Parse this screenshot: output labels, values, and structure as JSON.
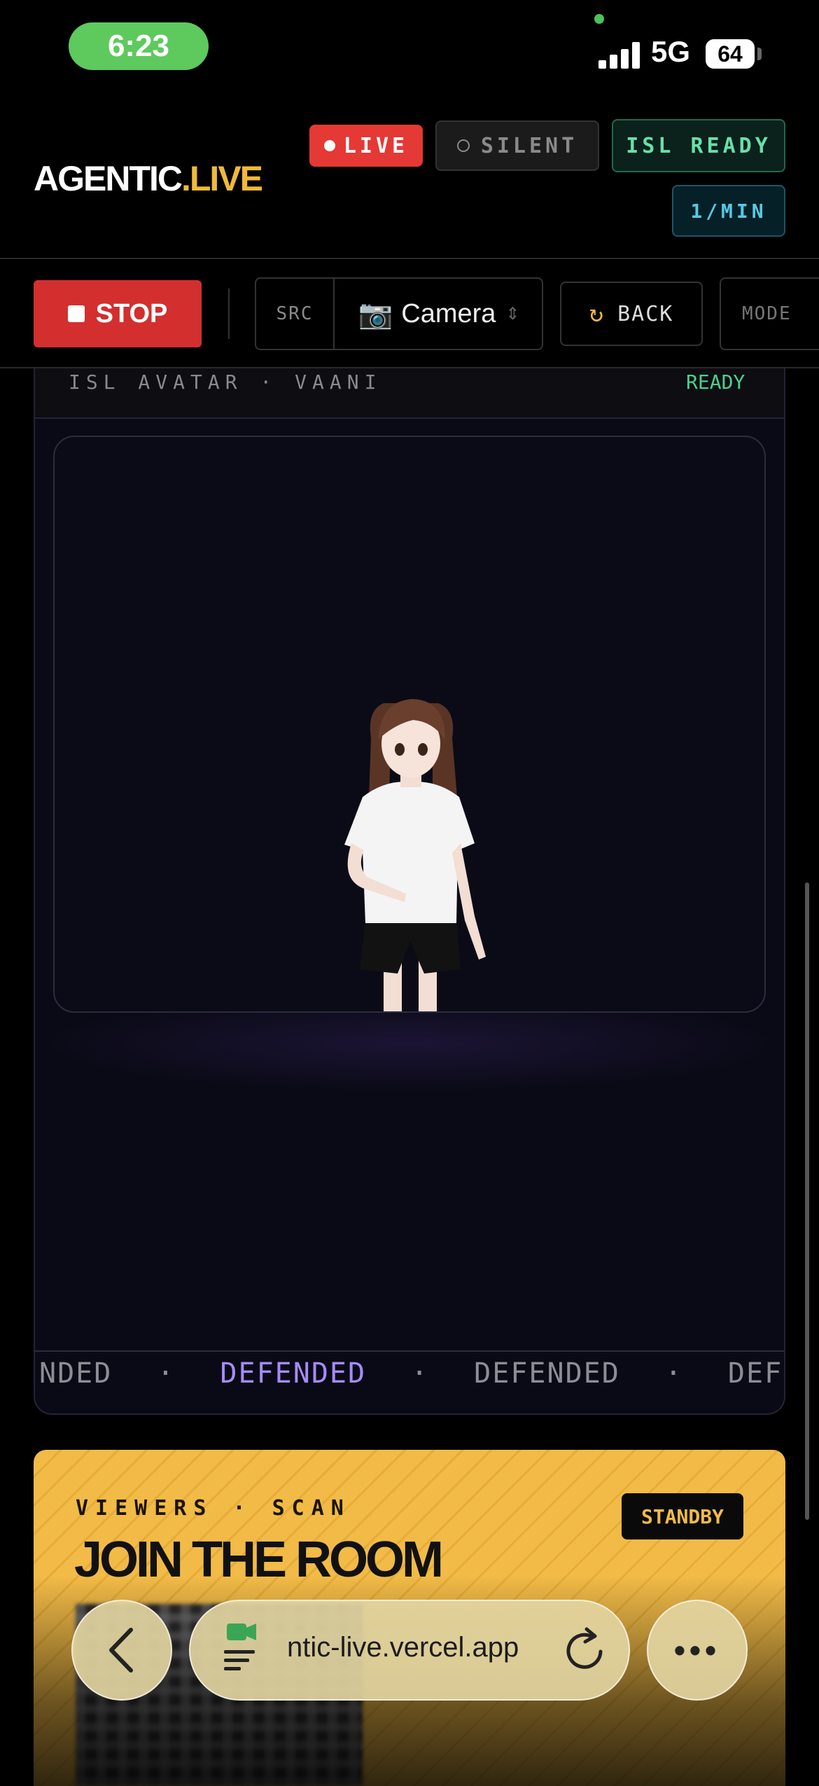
{
  "status_bar": {
    "time": "6:23",
    "network": "5G",
    "battery": "64"
  },
  "header": {
    "logo_main": "AGENTIC",
    "logo_accent": ".LIVE",
    "live_label": "LIVE",
    "silent_label": "SILENT",
    "isl_label": "ISL READY",
    "rate_label": "1/MIN"
  },
  "toolbar": {
    "stop_label": "STOP",
    "src_label": "SRC",
    "source_value": "Camera",
    "back_label": "BACK",
    "mode_label": "MODE"
  },
  "avatar_panel": {
    "title": "ISL AVATAR · VAANI",
    "status": "READY",
    "ticker": [
      "NDED",
      "DEFENDED",
      "DEFENDED",
      "DEFE"
    ],
    "ticker_sep": "·"
  },
  "join_card": {
    "label": "VIEWERS · SCAN",
    "title": "JOIN THE ROOM",
    "badge": "STANDBY"
  },
  "browser": {
    "url": "ntic-live.vercel.app"
  },
  "colors": {
    "live": "#e53935",
    "isl_ready": "#68e0a8",
    "rate": "#57c9e4",
    "accent": "#f0b93a",
    "stop": "#d32f2f",
    "ticker_highlight": "#a78bfa"
  }
}
